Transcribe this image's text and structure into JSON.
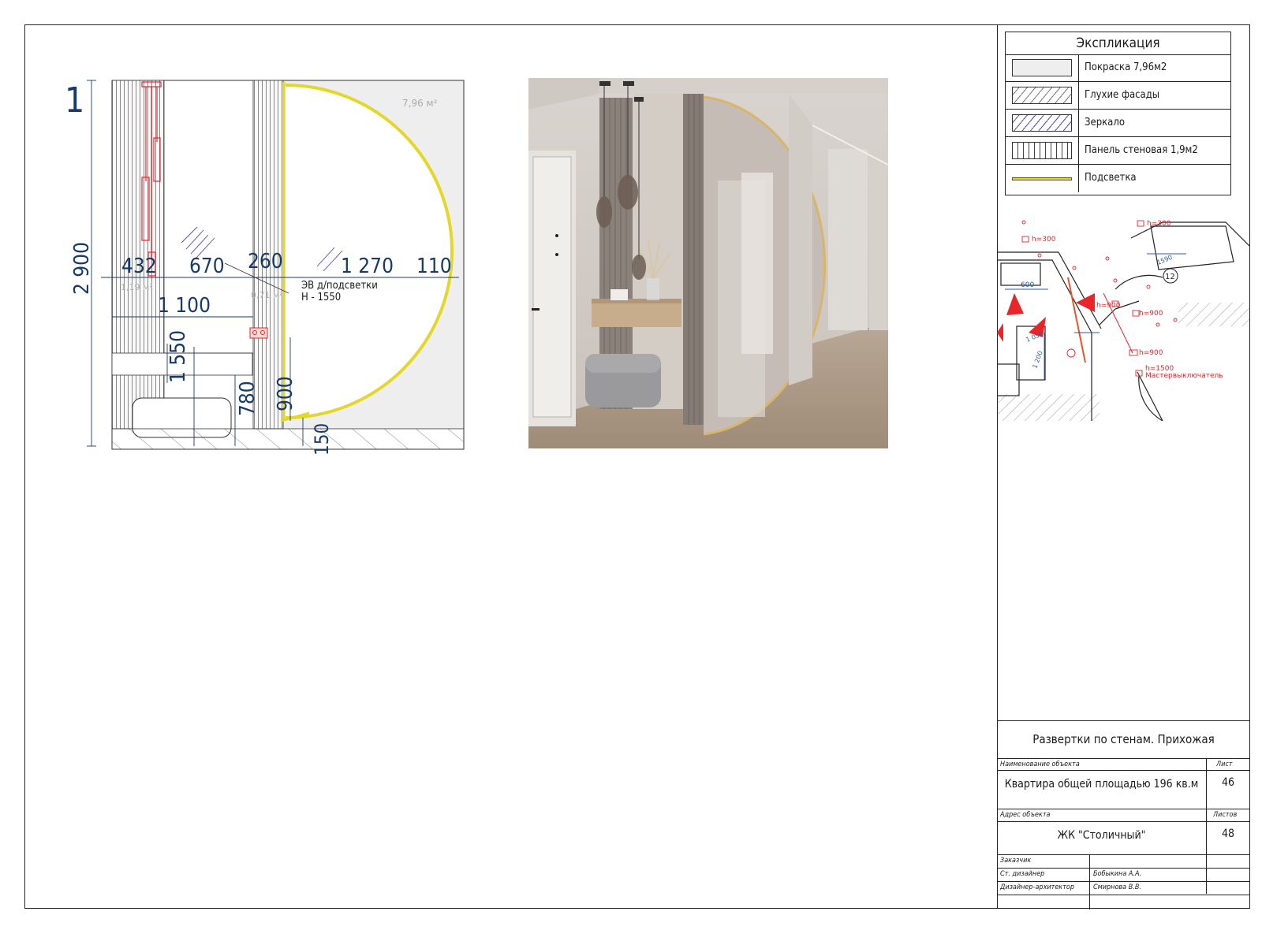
{
  "drawing": {
    "view_number": "1",
    "area_main": "7,96 м²",
    "area_left": "1,19 м²",
    "area_mid": "0,71 м²",
    "dims": {
      "height_total": "2 900",
      "w432": "432",
      "w670": "670",
      "w260": "260",
      "w1270": "1 270",
      "w110": "110",
      "w1100": "1 100",
      "h1550": "1 550",
      "h780": "780",
      "h900": "900",
      "h150": "150"
    },
    "note_line1": "ЭВ д/подсветки",
    "note_line2": "H - 1550"
  },
  "legend": {
    "title": "Экспликация",
    "items": [
      {
        "label": "Покраска 7,96м2",
        "swatch": "paint"
      },
      {
        "label": "Глухие фасады",
        "swatch": "hatch-gray"
      },
      {
        "label": "Зеркало",
        "swatch": "hatch-blue"
      },
      {
        "label": "Панель стеновая 1,9м2",
        "swatch": "panel"
      },
      {
        "label": "Подсветка",
        "swatch": "light"
      }
    ]
  },
  "keyplan": {
    "labels": [
      "h=300",
      "h=300",
      "h=900",
      "h=900",
      "h=900",
      "h=1500",
      "Мастервыключатель",
      "600",
      "1590",
      "1 050",
      "1 200",
      "12"
    ]
  },
  "title_block": {
    "sheet_title": "Развертки по стенам. Прихожая",
    "object_label": "Наименование объекта",
    "object_value": "Квартира общей площадью 196 кв.м",
    "sheet_label": "Лист",
    "sheet_value": "46",
    "address_label": "Адрес объекта",
    "address_value": "ЖК \"Столичный\"",
    "sheets_label": "Листов",
    "sheets_value": "48",
    "customer_label": "Заказчик",
    "senior_designer_label": "Ст. дизайнер",
    "senior_designer_value": "Бобыкина А.А.",
    "designer_label": "Дизайнер-архитектор",
    "designer_value": "Смирнова В.В."
  },
  "colors": {
    "dimension": "#173a6b",
    "accent_red": "#e8262a",
    "light_yellow": "#e3d72a",
    "paint_fill": "#eeeeee"
  }
}
